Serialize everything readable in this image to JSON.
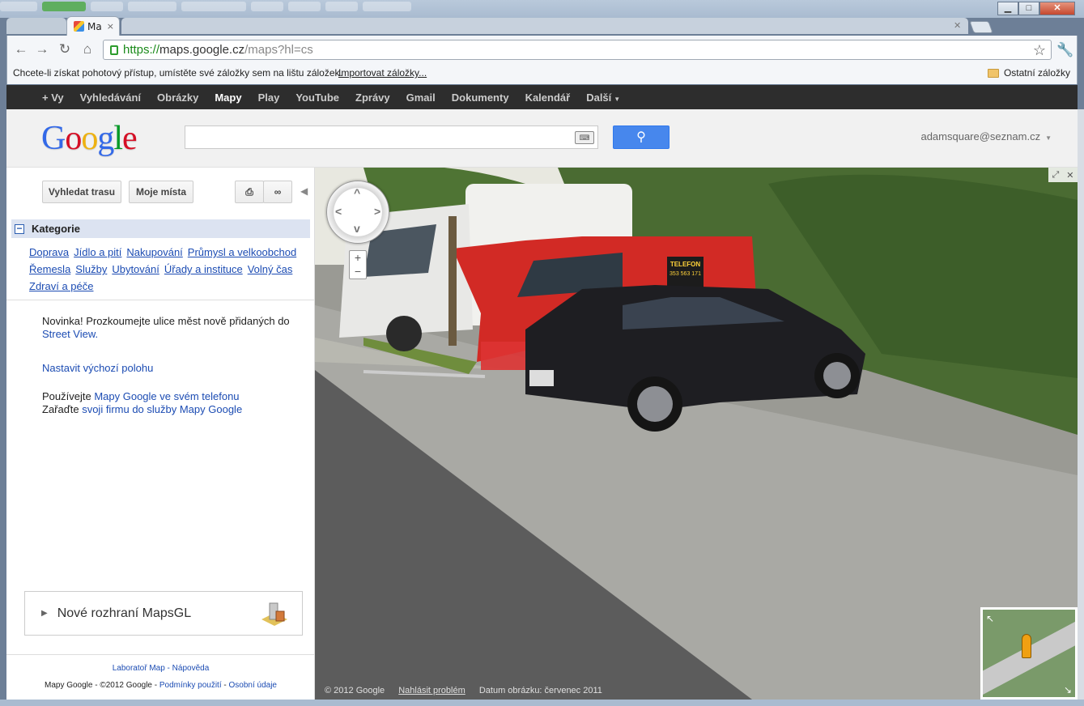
{
  "browser": {
    "tab_title": "Ma",
    "tab_close": "×",
    "url_scheme": "https://",
    "url_host": "maps.google.cz",
    "url_path": "/maps?hl=cs",
    "bookmarks_prompt": "Chcete-li získat pohotový přístup, umístěte své záložky sem na lištu záložek.",
    "import_bookmarks": "Importovat záložky...",
    "other_bookmarks": "Ostatní záložky"
  },
  "gbar": {
    "items": [
      "+ Vy",
      "Vyhledávání",
      "Obrázky",
      "Mapy",
      "Play",
      "YouTube",
      "Zprávy",
      "Gmail",
      "Dokumenty",
      "Kalendář",
      "Další"
    ],
    "active": "Mapy"
  },
  "header": {
    "logo": [
      "G",
      "o",
      "o",
      "g",
      "l",
      "e"
    ],
    "search_value": "",
    "account": "adamsquare@seznam.cz"
  },
  "panel": {
    "directions_button": "Vyhledat trasu",
    "my_places_button": "Moje místa",
    "categories_title": "Kategorie",
    "categories": [
      "Doprava",
      "Jídlo a pití",
      "Nakupování",
      "Průmysl a velkoobchod",
      "Řemesla",
      "Služby",
      "Ubytování",
      "Úřady a instituce",
      "Volný čas",
      "Zdraví a péče"
    ],
    "news_text": "Novinka! Prozkoumejte ulice měst nově přidaných do",
    "news_link": "Street View.",
    "set_default": "Nastavit výchozí polohu",
    "use_prefix": "Používejte",
    "use_link": "Mapy Google ve svém telefonu",
    "add_prefix": "Zařaďte",
    "add_link": "svoji firmu do služby Mapy Google",
    "mapsgl": "Nové rozhraní MapsGL",
    "footer_lab": "Laboratoř Map",
    "footer_help": "Nápověda",
    "footer_copy": "Mapy Google - ©2012 Google -",
    "footer_terms": "Podmínky použití",
    "footer_privacy": "Osobní údaje"
  },
  "streetview": {
    "copyright": "© 2012 Google",
    "report": "Nahlásit problém",
    "image_date": "Datum obrázku: červenec 2011",
    "car_sign": "TELEFON",
    "car_phone": "353 563 171"
  },
  "colors": {
    "link": "#1c4cb3",
    "gbar_bg": "#2d2d2d",
    "search_button": "#4787ed",
    "category_header": "#dce3f1"
  }
}
